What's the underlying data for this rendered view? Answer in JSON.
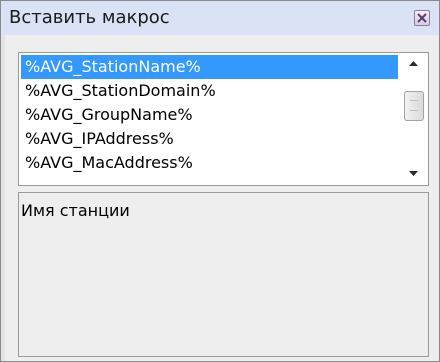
{
  "window": {
    "title": "Вставить макрос",
    "close_icon": "close-icon"
  },
  "macro_list": {
    "items": [
      {
        "label": "%AVG_StationName%",
        "selected": true
      },
      {
        "label": "%AVG_StationDomain%",
        "selected": false
      },
      {
        "label": "%AVG_GroupName%",
        "selected": false
      },
      {
        "label": "%AVG_IPAddress%",
        "selected": false
      },
      {
        "label": "%AVG_MacAddress%",
        "selected": false
      }
    ]
  },
  "description": {
    "text": "Имя станции"
  },
  "colors": {
    "selection": "#3399ff",
    "titlebar": "#d9e3f5",
    "panel": "#eeeeee"
  }
}
